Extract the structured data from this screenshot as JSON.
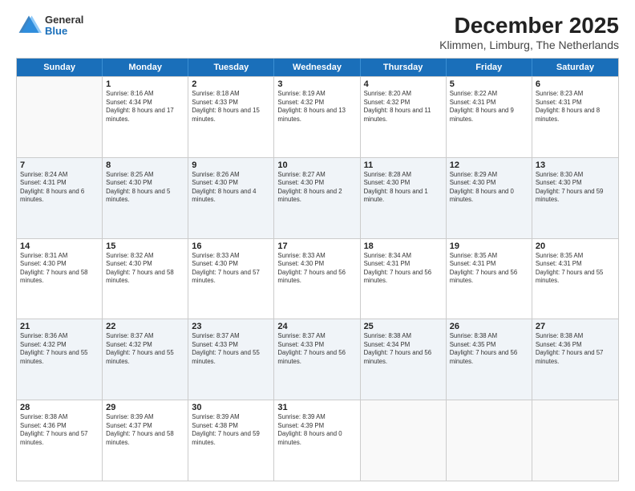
{
  "logo": {
    "general": "General",
    "blue": "Blue"
  },
  "title": "December 2025",
  "subtitle": "Klimmen, Limburg, The Netherlands",
  "header_days": [
    "Sunday",
    "Monday",
    "Tuesday",
    "Wednesday",
    "Thursday",
    "Friday",
    "Saturday"
  ],
  "weeks": [
    [
      {
        "day": "",
        "sunrise": "",
        "sunset": "",
        "daylight": "",
        "empty": true
      },
      {
        "day": "1",
        "sunrise": "Sunrise: 8:16 AM",
        "sunset": "Sunset: 4:34 PM",
        "daylight": "Daylight: 8 hours and 17 minutes."
      },
      {
        "day": "2",
        "sunrise": "Sunrise: 8:18 AM",
        "sunset": "Sunset: 4:33 PM",
        "daylight": "Daylight: 8 hours and 15 minutes."
      },
      {
        "day": "3",
        "sunrise": "Sunrise: 8:19 AM",
        "sunset": "Sunset: 4:32 PM",
        "daylight": "Daylight: 8 hours and 13 minutes."
      },
      {
        "day": "4",
        "sunrise": "Sunrise: 8:20 AM",
        "sunset": "Sunset: 4:32 PM",
        "daylight": "Daylight: 8 hours and 11 minutes."
      },
      {
        "day": "5",
        "sunrise": "Sunrise: 8:22 AM",
        "sunset": "Sunset: 4:31 PM",
        "daylight": "Daylight: 8 hours and 9 minutes."
      },
      {
        "day": "6",
        "sunrise": "Sunrise: 8:23 AM",
        "sunset": "Sunset: 4:31 PM",
        "daylight": "Daylight: 8 hours and 8 minutes."
      }
    ],
    [
      {
        "day": "7",
        "sunrise": "Sunrise: 8:24 AM",
        "sunset": "Sunset: 4:31 PM",
        "daylight": "Daylight: 8 hours and 6 minutes."
      },
      {
        "day": "8",
        "sunrise": "Sunrise: 8:25 AM",
        "sunset": "Sunset: 4:30 PM",
        "daylight": "Daylight: 8 hours and 5 minutes."
      },
      {
        "day": "9",
        "sunrise": "Sunrise: 8:26 AM",
        "sunset": "Sunset: 4:30 PM",
        "daylight": "Daylight: 8 hours and 4 minutes."
      },
      {
        "day": "10",
        "sunrise": "Sunrise: 8:27 AM",
        "sunset": "Sunset: 4:30 PM",
        "daylight": "Daylight: 8 hours and 2 minutes."
      },
      {
        "day": "11",
        "sunrise": "Sunrise: 8:28 AM",
        "sunset": "Sunset: 4:30 PM",
        "daylight": "Daylight: 8 hours and 1 minute."
      },
      {
        "day": "12",
        "sunrise": "Sunrise: 8:29 AM",
        "sunset": "Sunset: 4:30 PM",
        "daylight": "Daylight: 8 hours and 0 minutes."
      },
      {
        "day": "13",
        "sunrise": "Sunrise: 8:30 AM",
        "sunset": "Sunset: 4:30 PM",
        "daylight": "Daylight: 7 hours and 59 minutes."
      }
    ],
    [
      {
        "day": "14",
        "sunrise": "Sunrise: 8:31 AM",
        "sunset": "Sunset: 4:30 PM",
        "daylight": "Daylight: 7 hours and 58 minutes."
      },
      {
        "day": "15",
        "sunrise": "Sunrise: 8:32 AM",
        "sunset": "Sunset: 4:30 PM",
        "daylight": "Daylight: 7 hours and 58 minutes."
      },
      {
        "day": "16",
        "sunrise": "Sunrise: 8:33 AM",
        "sunset": "Sunset: 4:30 PM",
        "daylight": "Daylight: 7 hours and 57 minutes."
      },
      {
        "day": "17",
        "sunrise": "Sunrise: 8:33 AM",
        "sunset": "Sunset: 4:30 PM",
        "daylight": "Daylight: 7 hours and 56 minutes."
      },
      {
        "day": "18",
        "sunrise": "Sunrise: 8:34 AM",
        "sunset": "Sunset: 4:31 PM",
        "daylight": "Daylight: 7 hours and 56 minutes."
      },
      {
        "day": "19",
        "sunrise": "Sunrise: 8:35 AM",
        "sunset": "Sunset: 4:31 PM",
        "daylight": "Daylight: 7 hours and 56 minutes."
      },
      {
        "day": "20",
        "sunrise": "Sunrise: 8:35 AM",
        "sunset": "Sunset: 4:31 PM",
        "daylight": "Daylight: 7 hours and 55 minutes."
      }
    ],
    [
      {
        "day": "21",
        "sunrise": "Sunrise: 8:36 AM",
        "sunset": "Sunset: 4:32 PM",
        "daylight": "Daylight: 7 hours and 55 minutes."
      },
      {
        "day": "22",
        "sunrise": "Sunrise: 8:37 AM",
        "sunset": "Sunset: 4:32 PM",
        "daylight": "Daylight: 7 hours and 55 minutes."
      },
      {
        "day": "23",
        "sunrise": "Sunrise: 8:37 AM",
        "sunset": "Sunset: 4:33 PM",
        "daylight": "Daylight: 7 hours and 55 minutes."
      },
      {
        "day": "24",
        "sunrise": "Sunrise: 8:37 AM",
        "sunset": "Sunset: 4:33 PM",
        "daylight": "Daylight: 7 hours and 56 minutes."
      },
      {
        "day": "25",
        "sunrise": "Sunrise: 8:38 AM",
        "sunset": "Sunset: 4:34 PM",
        "daylight": "Daylight: 7 hours and 56 minutes."
      },
      {
        "day": "26",
        "sunrise": "Sunrise: 8:38 AM",
        "sunset": "Sunset: 4:35 PM",
        "daylight": "Daylight: 7 hours and 56 minutes."
      },
      {
        "day": "27",
        "sunrise": "Sunrise: 8:38 AM",
        "sunset": "Sunset: 4:36 PM",
        "daylight": "Daylight: 7 hours and 57 minutes."
      }
    ],
    [
      {
        "day": "28",
        "sunrise": "Sunrise: 8:38 AM",
        "sunset": "Sunset: 4:36 PM",
        "daylight": "Daylight: 7 hours and 57 minutes."
      },
      {
        "day": "29",
        "sunrise": "Sunrise: 8:39 AM",
        "sunset": "Sunset: 4:37 PM",
        "daylight": "Daylight: 7 hours and 58 minutes."
      },
      {
        "day": "30",
        "sunrise": "Sunrise: 8:39 AM",
        "sunset": "Sunset: 4:38 PM",
        "daylight": "Daylight: 7 hours and 59 minutes."
      },
      {
        "day": "31",
        "sunrise": "Sunrise: 8:39 AM",
        "sunset": "Sunset: 4:39 PM",
        "daylight": "Daylight: 8 hours and 0 minutes."
      },
      {
        "day": "",
        "sunrise": "",
        "sunset": "",
        "daylight": "",
        "empty": true
      },
      {
        "day": "",
        "sunrise": "",
        "sunset": "",
        "daylight": "",
        "empty": true
      },
      {
        "day": "",
        "sunrise": "",
        "sunset": "",
        "daylight": "",
        "empty": true
      }
    ]
  ]
}
